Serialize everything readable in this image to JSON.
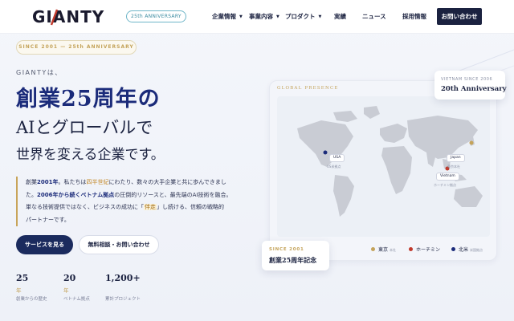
{
  "header": {
    "logo": "GIANTY",
    "anniversary_badge": "25th ANNIVERSARY",
    "nav": [
      {
        "label": "企業情報",
        "has_dropdown": true
      },
      {
        "label": "事業内容",
        "has_dropdown": true
      },
      {
        "label": "プロダクト",
        "has_dropdown": true
      },
      {
        "label": "実績",
        "has_dropdown": false
      },
      {
        "label": "ニュース",
        "has_dropdown": false
      },
      {
        "label": "採用情報",
        "has_dropdown": false
      }
    ],
    "contact_button": "お問い合わせ"
  },
  "hero": {
    "since_pill": "SINCE 2001 — 25th ANNIVERSARY",
    "intro": "GIANTYは、",
    "headline_1": "創業25周年の",
    "headline_2": "AIとグローバルで",
    "headline_3": "世界を変える企業です。",
    "description": {
      "l1_a": "創業",
      "l1_b": "2001年",
      "l1_c": "。私たちは",
      "l1_d": "四半世紀",
      "l1_e": "にわたり、数々の大手企業と共に歩んできまし",
      "l2_a": "た。",
      "l2_b": "2006年から続くベトナム拠点",
      "l2_c": "の圧倒的リソースと、最先端のAI技術を融合。",
      "l3_a": "単なる技術提供ではなく、ビジネスの成功に「",
      "l3_b": "伴走",
      "l3_c": "」し続ける、信頼の戦略的",
      "l4": "パートナーです。"
    },
    "primary_button": "サービスを見る",
    "secondary_button": "無料相談・お問い合わせ",
    "stats": [
      {
        "value": "25",
        "unit": "年",
        "label": "創業からの歴史"
      },
      {
        "value": "20",
        "unit": "年",
        "label": "ベトナム拠点"
      },
      {
        "value": "1,200+",
        "unit": "",
        "label": "累計プロジェクト"
      }
    ]
  },
  "global_panel": {
    "label": "GLOBAL PRESENCE",
    "locations": [
      {
        "name": "USA",
        "sub": "US米拠点"
      },
      {
        "name": "Japan",
        "sub": "東京本社"
      },
      {
        "name": "Vietnam",
        "sub": "ホーチミン拠点"
      }
    ],
    "legend": [
      {
        "label": "東京",
        "sub": "本社",
        "color": "#c4a35a"
      },
      {
        "label": "ホーチミン",
        "sub": "",
        "color": "#c0392b"
      },
      {
        "label": "北米",
        "sub": "米国拠点",
        "color": "#1b2b7a"
      }
    ],
    "vietnam_card": {
      "small": "VIETNAM SINCE 2006",
      "big": "20th Anniversary"
    },
    "since_card": {
      "small": "SINCE 2001",
      "big": "創業25周年記念"
    }
  },
  "colors": {
    "navy": "#1b2240",
    "accent_blue": "#1b2b7a",
    "gold": "#c4a35a",
    "red": "#c0392b",
    "badge_teal": "#3a8ba0"
  }
}
